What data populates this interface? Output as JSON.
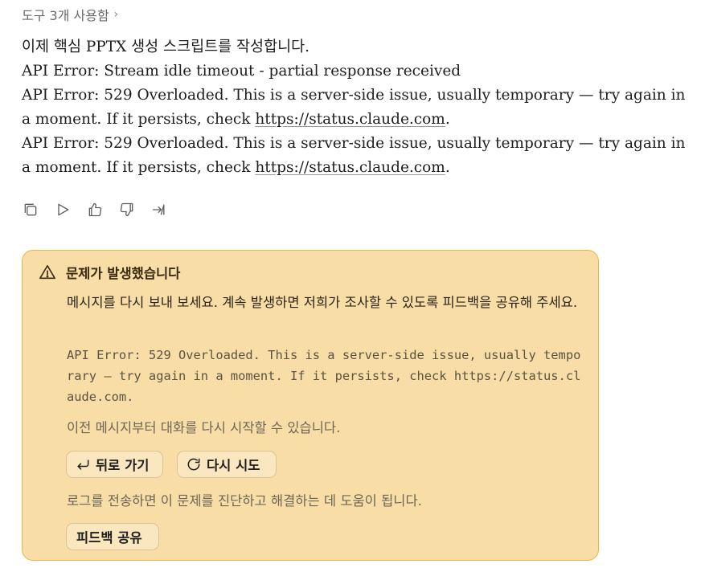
{
  "tools": {
    "label": "도구 3개 사용함",
    "chevron": "›"
  },
  "message": {
    "line1": "이제 핵심 PPTX 생성 스크립트를 작성합니다.",
    "line2": "API Error: Stream idle timeout - partial response received",
    "line3_prefix": "API Error: 529 Overloaded. This is a server-side issue, usually temporary — try again in a moment. If it persists, check ",
    "line3_link": "https://status.claude.com",
    "line3_suffix": ".",
    "line4_prefix": "API Error: 529 Overloaded. This is a server-side issue, usually temporary — try again in a moment. If it persists, check ",
    "line4_link": "https://status.claude.com",
    "line4_suffix": "."
  },
  "actions": {
    "icons": [
      "copy-icon",
      "play-icon",
      "thumbs-up-icon",
      "thumbs-down-icon",
      "share-arrow-icon"
    ]
  },
  "alert": {
    "title": "문제가 발생했습니다",
    "body": "메시지를 다시 보내 보세요. 계속 발생하면 저희가 조사할 수 있도록 피드백을 공유해 주세요.",
    "code": "API Error: 529 Overloaded. This is a server-side issue, usually temporary — try again in a moment. If it persists, check https://status.claude.com.",
    "note": "이전 메시지부터 대화를 다시 시작할 수 있습니다.",
    "back_label": "뒤로 가기",
    "retry_label": "다시 시도",
    "note2": "로그를 전송하면 이 문제를 진단하고 해결하는 데 도움이 됩니다.",
    "share_label": "피드백 공유",
    "colors": {
      "background": "#f8dda6",
      "border": "#e9b54a"
    }
  }
}
